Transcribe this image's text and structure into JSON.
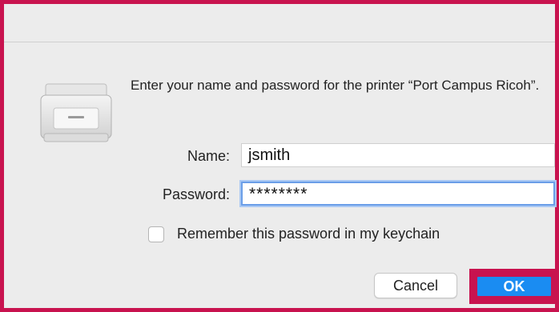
{
  "dialog": {
    "message": "Enter your name and password for the printer “Port Campus Ricoh”.",
    "icon": "printer-icon"
  },
  "form": {
    "name_label": "Name:",
    "name_value": "jsmith",
    "password_label": "Password:",
    "password_value": "********",
    "remember_label": "Remember this password in my keychain",
    "remember_checked": false
  },
  "buttons": {
    "cancel": "Cancel",
    "ok": "OK"
  },
  "colors": {
    "highlight": "#c8134f",
    "accent": "#1a8cf2",
    "focus_ring": "#6a9ee8"
  }
}
